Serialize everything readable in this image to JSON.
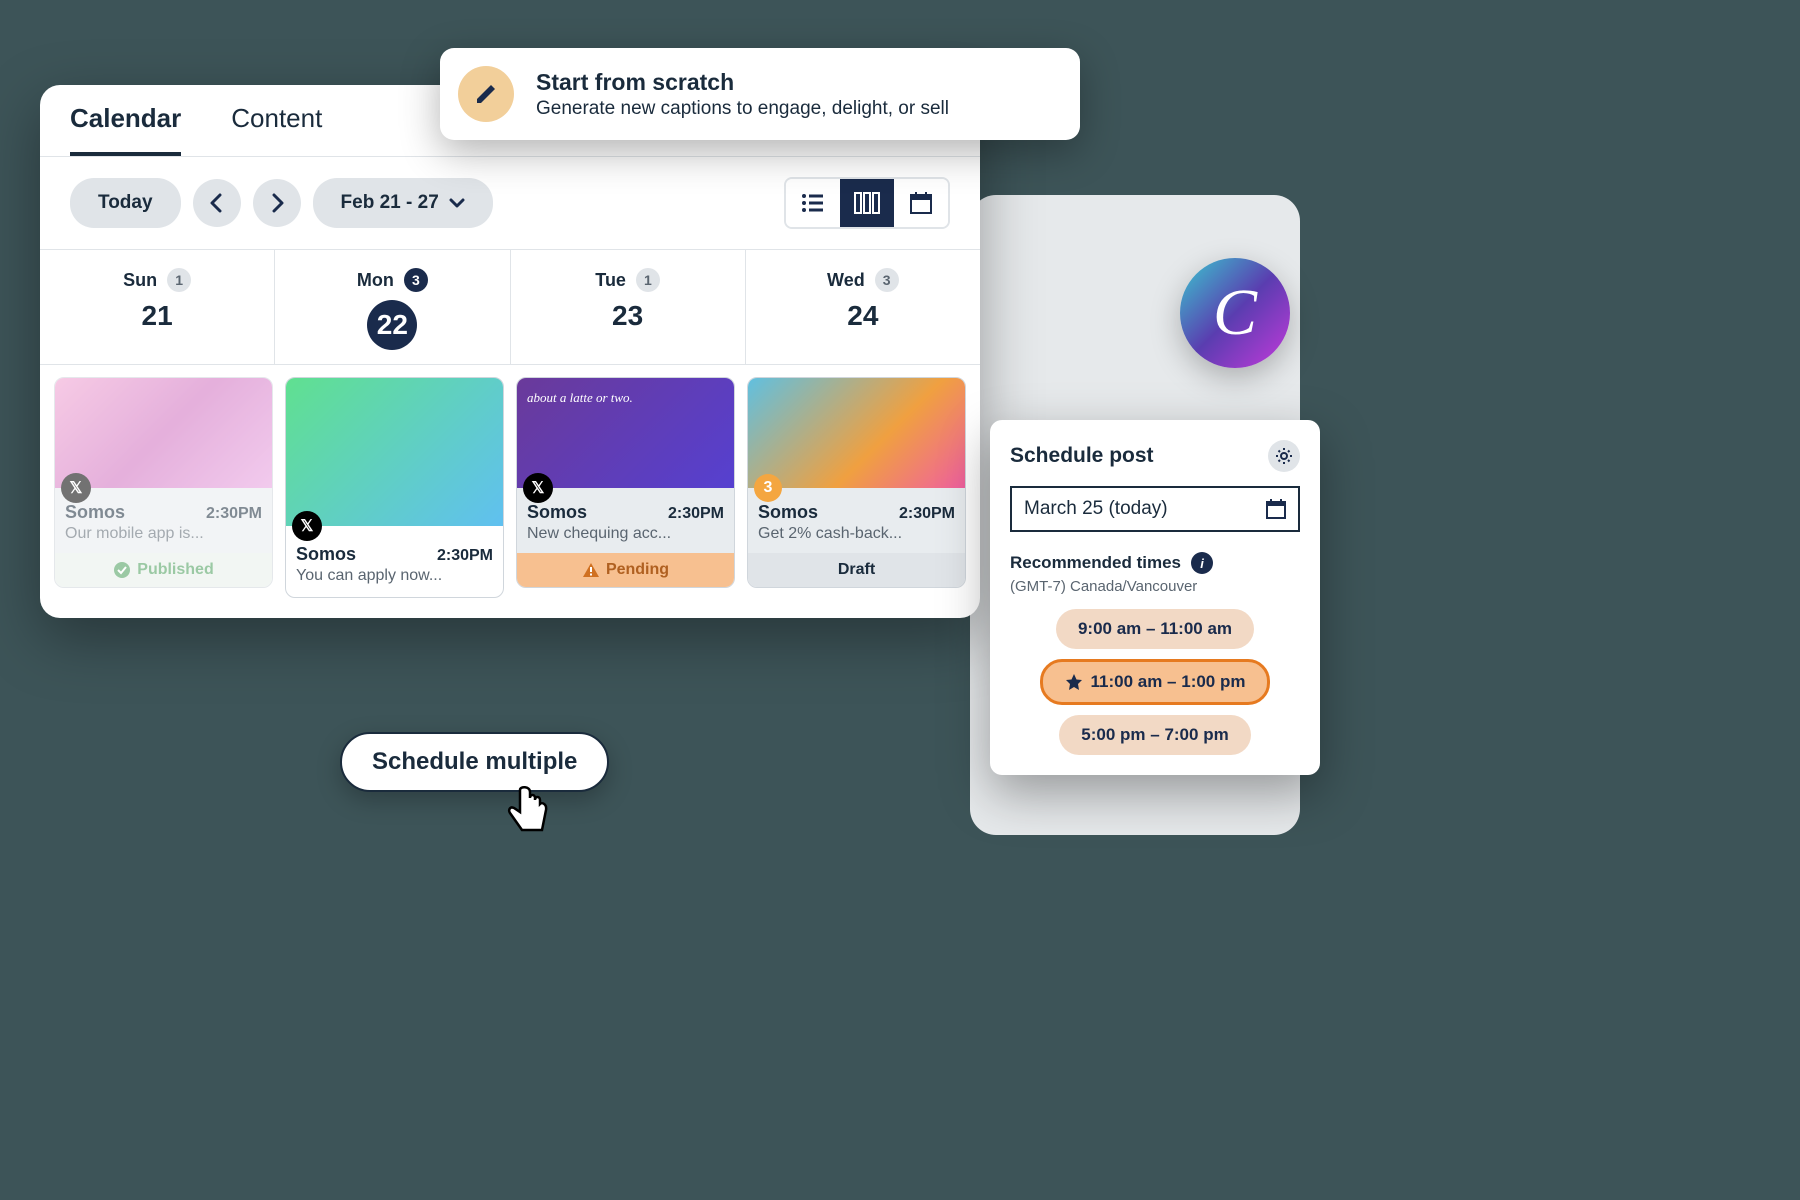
{
  "tabs": {
    "calendar": "Calendar",
    "content": "Content"
  },
  "toolbar": {
    "today": "Today",
    "date_range": "Feb 21 - 27"
  },
  "days": [
    {
      "name": "Sun",
      "num": "21",
      "count": "1"
    },
    {
      "name": "Mon",
      "num": "22",
      "count": "3"
    },
    {
      "name": "Tue",
      "num": "23",
      "count": "1"
    },
    {
      "name": "Wed",
      "num": "24",
      "count": "3"
    }
  ],
  "posts": [
    {
      "account": "Somos",
      "time": "2:30PM",
      "excerpt": "Our mobile app is...",
      "status": "Published"
    },
    {
      "account": "Somos",
      "time": "2:30PM",
      "excerpt": "You can apply now..."
    },
    {
      "thumb_text": "about a latte or two.",
      "account": "Somos",
      "time": "2:30PM",
      "excerpt": "New chequing acc...",
      "status": "Pending"
    },
    {
      "badge": "3",
      "account": "Somos",
      "time": "2:30PM",
      "excerpt": "Get 2% cash-back...",
      "status": "Draft"
    }
  ],
  "scratch": {
    "title": "Start from scratch",
    "subtitle": "Generate new captions to engage, delight, or sell"
  },
  "schedule_multi": "Schedule multiple",
  "canva": "C",
  "panel": {
    "title": "Schedule post",
    "date": "March 25 (today)",
    "rec_label": "Recommended times",
    "tz": "(GMT-7) Canada/Vancouver",
    "slots": [
      "9:00 am – 11:00 am",
      "11:00 am – 1:00 pm",
      "5:00 pm – 7:00 pm"
    ]
  }
}
